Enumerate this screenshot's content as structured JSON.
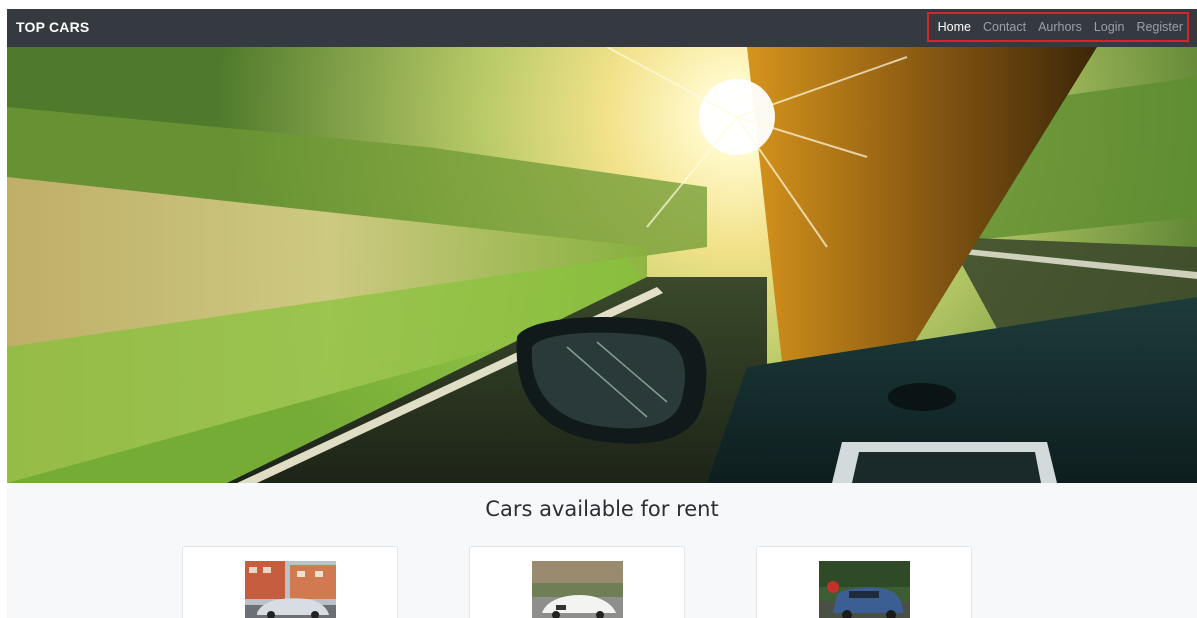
{
  "navbar": {
    "brand": "TOP CARS",
    "links": [
      {
        "label": "Home",
        "active": true
      },
      {
        "label": "Contact",
        "active": false
      },
      {
        "label": "Aurhors",
        "active": false
      },
      {
        "label": "Login",
        "active": false
      },
      {
        "label": "Register",
        "active": false
      }
    ],
    "background": "#343a40",
    "highlight_color": "#d9232a"
  },
  "hero": {
    "image": "car-interior-driving-road-photo"
  },
  "main": {
    "heading": "Cars available for rent",
    "cards": [
      {
        "image": "silver-sedan-photo"
      },
      {
        "image": "white-convertible-photo"
      },
      {
        "image": "blue-suv-photo"
      }
    ]
  }
}
